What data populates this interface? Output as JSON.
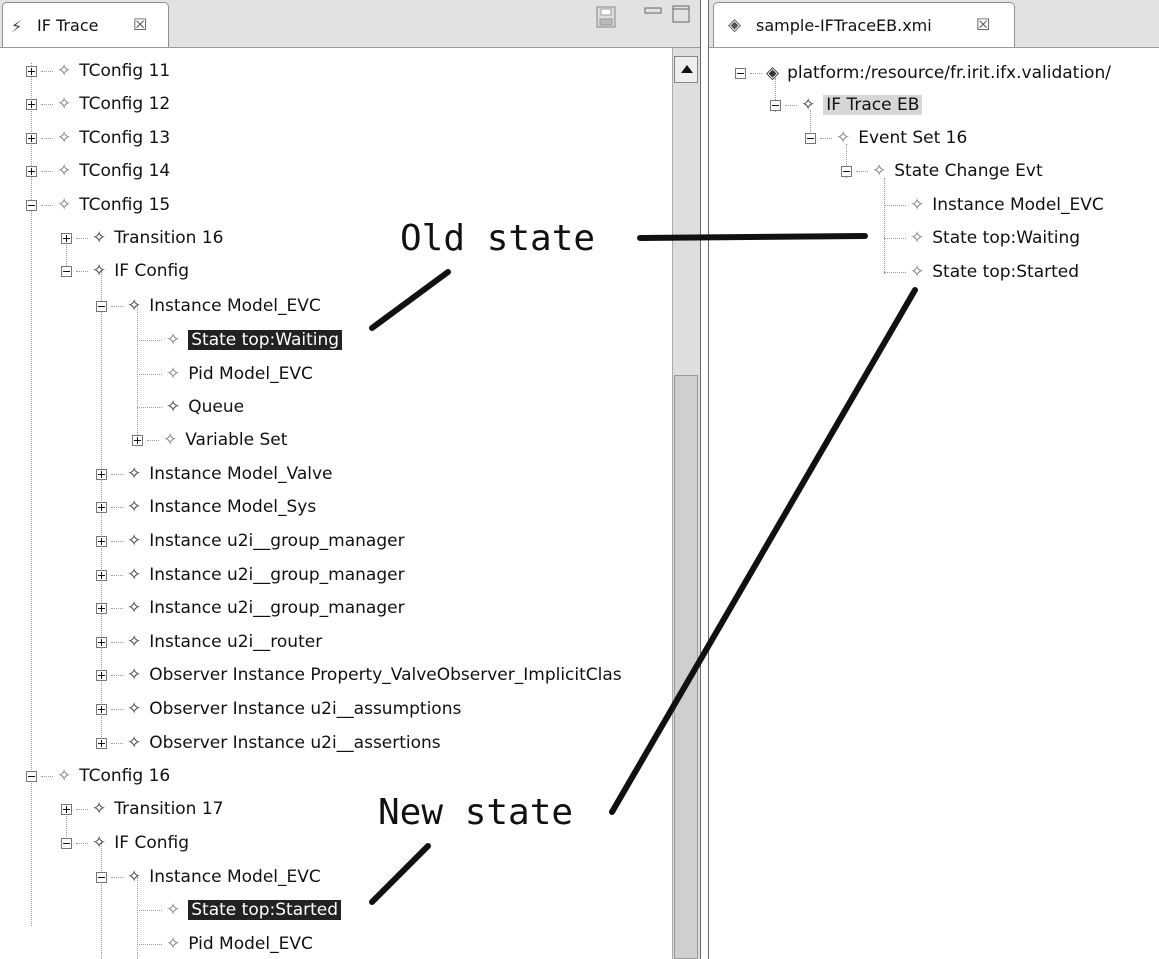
{
  "left_view": {
    "title": "IF Trace",
    "close_glyph": "☒",
    "controls": [
      "save-icon",
      "minimize-icon",
      "maximize-icon"
    ]
  },
  "right_view": {
    "title": "sample-IFTraceEB.xmi",
    "close_glyph": "☒"
  },
  "left_tree": [
    {
      "label": "TConfig 11",
      "toggle": "plus",
      "level": 0
    },
    {
      "label": "TConfig 12",
      "toggle": "plus",
      "level": 0
    },
    {
      "label": "TConfig 13",
      "toggle": "plus",
      "level": 0
    },
    {
      "label": "TConfig 14",
      "toggle": "plus",
      "level": 0
    },
    {
      "label": "TConfig 15",
      "toggle": "minus",
      "level": 0
    },
    {
      "label": "Transition 16",
      "toggle": "plus",
      "level": 1
    },
    {
      "label": "IF Config",
      "toggle": "minus",
      "level": 1
    },
    {
      "label": "Instance Model_EVC",
      "toggle": "minus",
      "level": 2
    },
    {
      "label": "State top:Waiting",
      "toggle": "none",
      "level": 3,
      "selected": true
    },
    {
      "label": "Pid Model_EVC",
      "toggle": "none",
      "level": 3
    },
    {
      "label": "Queue",
      "toggle": "none",
      "level": 3
    },
    {
      "label": "Variable Set",
      "toggle": "plus",
      "level": 3
    },
    {
      "label": "Instance Model_Valve",
      "toggle": "plus",
      "level": 2
    },
    {
      "label": "Instance Model_Sys",
      "toggle": "plus",
      "level": 2
    },
    {
      "label": "Instance u2i__group_manager",
      "toggle": "plus",
      "level": 2
    },
    {
      "label": "Instance u2i__group_manager",
      "toggle": "plus",
      "level": 2
    },
    {
      "label": "Instance u2i__group_manager",
      "toggle": "plus",
      "level": 2
    },
    {
      "label": "Instance u2i__router",
      "toggle": "plus",
      "level": 2
    },
    {
      "label": "Observer Instance Property_ValveObserver_ImplicitClas",
      "toggle": "plus",
      "level": 2
    },
    {
      "label": "Observer Instance u2i__assumptions",
      "toggle": "plus",
      "level": 2
    },
    {
      "label": "Observer Instance u2i__assertions",
      "toggle": "plus",
      "level": 2
    },
    {
      "label": "TConfig 16",
      "toggle": "minus",
      "level": 0
    },
    {
      "label": "Transition 17",
      "toggle": "plus",
      "level": 1
    },
    {
      "label": "IF Config",
      "toggle": "minus",
      "level": 1
    },
    {
      "label": "Instance Model_EVC",
      "toggle": "minus",
      "level": 2
    },
    {
      "label": "State top:Started",
      "toggle": "none",
      "level": 3,
      "selected": true
    },
    {
      "label": "Pid Model_EVC",
      "toggle": "none",
      "level": 3
    }
  ],
  "right_tree": [
    {
      "label": "platform:/resource/fr.irit.ifx.validation/",
      "toggle": "minus",
      "level": 0,
      "icon": "resource-icon"
    },
    {
      "label": "IF Trace EB",
      "toggle": "minus",
      "level": 1,
      "highlight": true
    },
    {
      "label": "Event Set 16",
      "toggle": "minus",
      "level": 2
    },
    {
      "label": "State Change Evt",
      "toggle": "minus",
      "level": 3
    },
    {
      "label": "Instance Model_EVC",
      "toggle": "none",
      "level": 4
    },
    {
      "label": "State top:Waiting",
      "toggle": "none",
      "level": 4
    },
    {
      "label": "State top:Started",
      "toggle": "none",
      "level": 4
    }
  ],
  "annotations": {
    "old_state": "Old state",
    "new_state": "New state"
  },
  "colors": {
    "selection_bg": "#222222",
    "selection_fg": "#ffffff",
    "tab_bar_bg": "#e2e2e2",
    "annotation_stroke": "#111111"
  }
}
